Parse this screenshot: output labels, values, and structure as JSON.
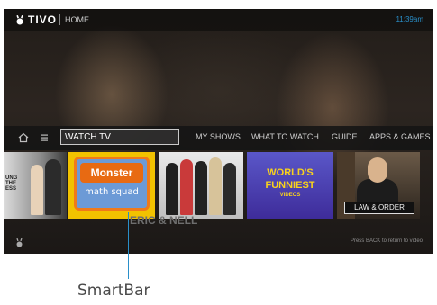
{
  "header": {
    "logo": "TIVO",
    "section": "HOME",
    "clock": "11:39am"
  },
  "smartbar": {
    "field_value": "WATCH TV",
    "nav": [
      "MY SHOWS",
      "WHAT TO WATCH",
      "GUIDE",
      "APPS & GAMES"
    ]
  },
  "tiles": {
    "t1_text": "UNG\nTHE\nESS",
    "t2_logo": "Monster",
    "t2_sub": "math squad",
    "t4_logo": [
      "WORLD'S",
      "FUNNIEST",
      "VIDEOS"
    ],
    "t5_label": "LAW & ORDER"
  },
  "selected": {
    "title": "ERIC & NELL"
  },
  "footer": {
    "hint": "Press BACK to return to video"
  },
  "callout": {
    "label": "SmartBar"
  },
  "colors": {
    "accent": "#2a8fc9",
    "tile_selected": "#f2c200"
  }
}
